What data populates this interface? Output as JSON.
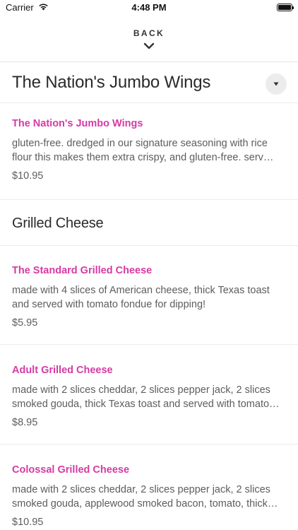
{
  "status_bar": {
    "carrier": "Carrier",
    "time": "4:48 PM",
    "icons": [
      "wifi-icon",
      "battery-icon"
    ],
    "battery_level": 1.0
  },
  "header": {
    "back_label": "BACK",
    "back_icon": "chevron-down-icon"
  },
  "colors": {
    "accent": "#d63aa5",
    "text": "#2a2a2a",
    "muted": "#5d5d5d",
    "divider": "#ececec"
  },
  "category": {
    "title": "The Nation's Jumbo Wings",
    "dropdown_icon": "caret-down-icon",
    "items": [
      {
        "name": "The Nation's Jumbo Wings",
        "desc_line1": "gluten-free. dredged in our signature seasoning with rice",
        "desc_line2": "flour this makes them extra crispy, and gluten-free. serv…",
        "price": "$10.95"
      }
    ]
  },
  "section": {
    "title": "Grilled Cheese",
    "items": [
      {
        "name": "The Standard Grilled Cheese",
        "desc_line1": "made with 4 slices of American cheese, thick Texas toast",
        "desc_line2": "and served with tomato fondue for dipping!",
        "price": "$5.95"
      },
      {
        "name": "Adult Grilled Cheese",
        "desc_line1": "made with 2 slices cheddar, 2 slices pepper jack, 2 slices",
        "desc_line2": "smoked gouda, thick Texas toast and served with tomato…",
        "price": "$8.95"
      },
      {
        "name": "Colossal Grilled Cheese",
        "desc_line1": "made with 2 slices cheddar, 2 slices pepper jack, 2 slices",
        "desc_line2": "smoked gouda, applewood smoked bacon, tomato, thick…",
        "price": "$10.95"
      }
    ]
  }
}
